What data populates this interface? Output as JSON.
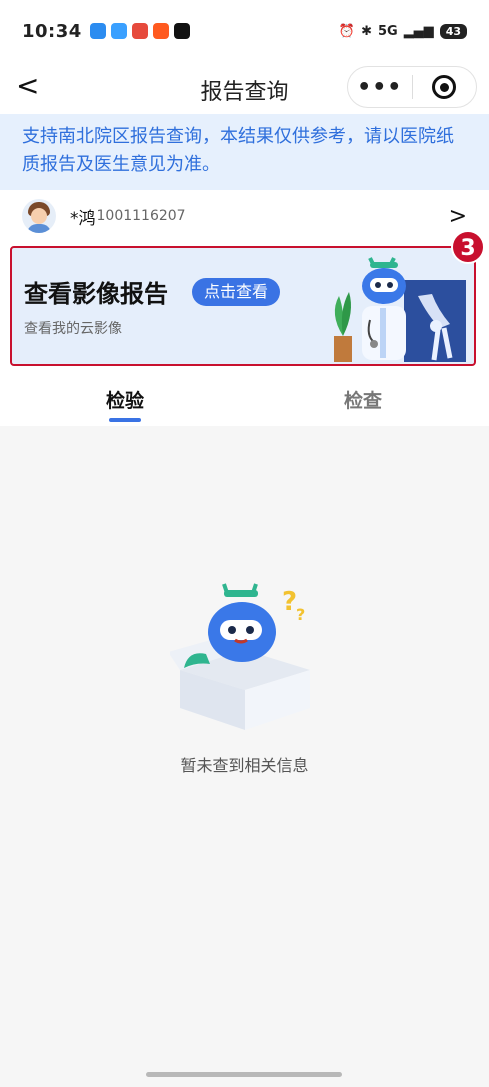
{
  "status_bar": {
    "time": "10:34",
    "network": "5G",
    "battery": "43"
  },
  "nav": {
    "back_glyph": "<",
    "title": "报告查询",
    "more_glyph": "•••"
  },
  "notice": {
    "text": "支持南北院区报告查询，本结果仅供参考，请以医院纸质报告及医生意见为准。"
  },
  "patient": {
    "name": "*鸿",
    "id": "1001116207",
    "chevron": ">"
  },
  "banner": {
    "title": "查看影像报告",
    "button_label": "点击查看",
    "subtitle": "查看我的云影像",
    "badge": "3"
  },
  "tabs": [
    {
      "label": "检验"
    },
    {
      "label": "检查"
    }
  ],
  "empty_state": {
    "text": "暂未查到相关信息"
  },
  "colors": {
    "accent": "#3a73e4",
    "notice_bg": "#e6f0fd",
    "notice_text": "#2f6fdc",
    "highlight": "#c8102e"
  }
}
